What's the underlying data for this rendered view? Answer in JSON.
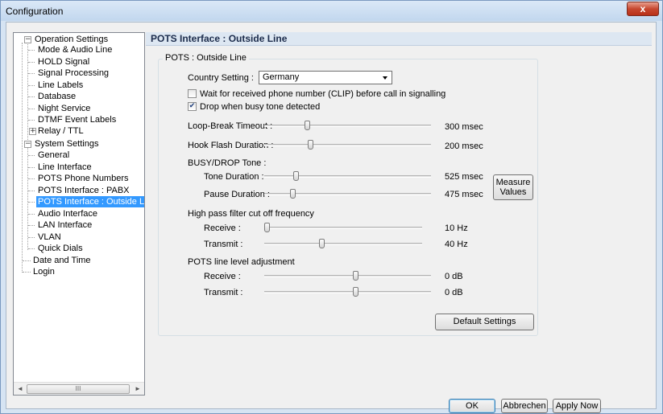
{
  "window": {
    "title": "Configuration",
    "close_label": "x"
  },
  "tree": {
    "items": [
      {
        "label": "Operation Settings"
      },
      {
        "label": "Mode & Audio Line"
      },
      {
        "label": "HOLD Signal"
      },
      {
        "label": "Signal Processing"
      },
      {
        "label": "Line Labels"
      },
      {
        "label": "Database"
      },
      {
        "label": "Night Service"
      },
      {
        "label": "DTMF Event Labels"
      },
      {
        "label": "Relay / TTL"
      },
      {
        "label": "System Settings"
      },
      {
        "label": "General"
      },
      {
        "label": "Line Interface"
      },
      {
        "label": "POTS Phone Numbers"
      },
      {
        "label": "POTS Interface : PABX"
      },
      {
        "label": "POTS Interface : Outside Lin",
        "selected": true
      },
      {
        "label": "Audio Interface"
      },
      {
        "label": "LAN Interface"
      },
      {
        "label": "VLAN"
      },
      {
        "label": "Quick Dials"
      },
      {
        "label": "Date and Time"
      },
      {
        "label": "Login"
      }
    ],
    "collapse_glyph": "−",
    "expand_glyph": "+",
    "scroll_left_arrow": "◄",
    "scroll_right_arrow": "►",
    "scroll_thumb_grip": "III"
  },
  "page": {
    "header": "POTS Interface : Outside Line",
    "group_title": "POTS : Outside Line",
    "country": {
      "label": "Country Setting :",
      "value": "Germany"
    },
    "checkboxes": {
      "clip": {
        "label": "Wait for received phone number (CLIP) before call in signalling",
        "checked": false
      },
      "busy": {
        "label": "Drop when busy tone detected",
        "checked": true
      }
    },
    "check_glyph": "✔",
    "sliders": {
      "loop_break": {
        "label": "Loop-Break Timeout :",
        "value": "300 msec",
        "position_fraction": 0.25
      },
      "hook_flash": {
        "label": "Hook Flash Duration :",
        "value": "200 msec",
        "position_fraction": 0.27
      },
      "tone_duration": {
        "label": "Tone Duration :",
        "value": "525 msec",
        "position_fraction": 0.18
      },
      "pause_duration": {
        "label": "Pause Duration :",
        "value": "475 msec",
        "position_fraction": 0.16
      },
      "hp_receive": {
        "label": "Receive :",
        "value": "10 Hz",
        "position_fraction": 0.0
      },
      "hp_transmit": {
        "label": "Transmit :",
        "value": "40 Hz",
        "position_fraction": 0.36
      },
      "level_receive": {
        "label": "Receive :",
        "value": "0 dB",
        "position_fraction": 0.55
      },
      "level_transmit": {
        "label": "Transmit :",
        "value": "0 dB",
        "position_fraction": 0.55
      }
    },
    "busy_drop_label": "BUSY/DROP Tone :",
    "high_pass_label": "High pass filter cut off frequency",
    "level_label": "POTS line level adjustment",
    "measure_button": [
      "Measure",
      "Values"
    ],
    "default_button": "Default Settings"
  },
  "footer": {
    "ok": "OK",
    "cancel": "Abbrechen",
    "apply": "Apply Now"
  }
}
